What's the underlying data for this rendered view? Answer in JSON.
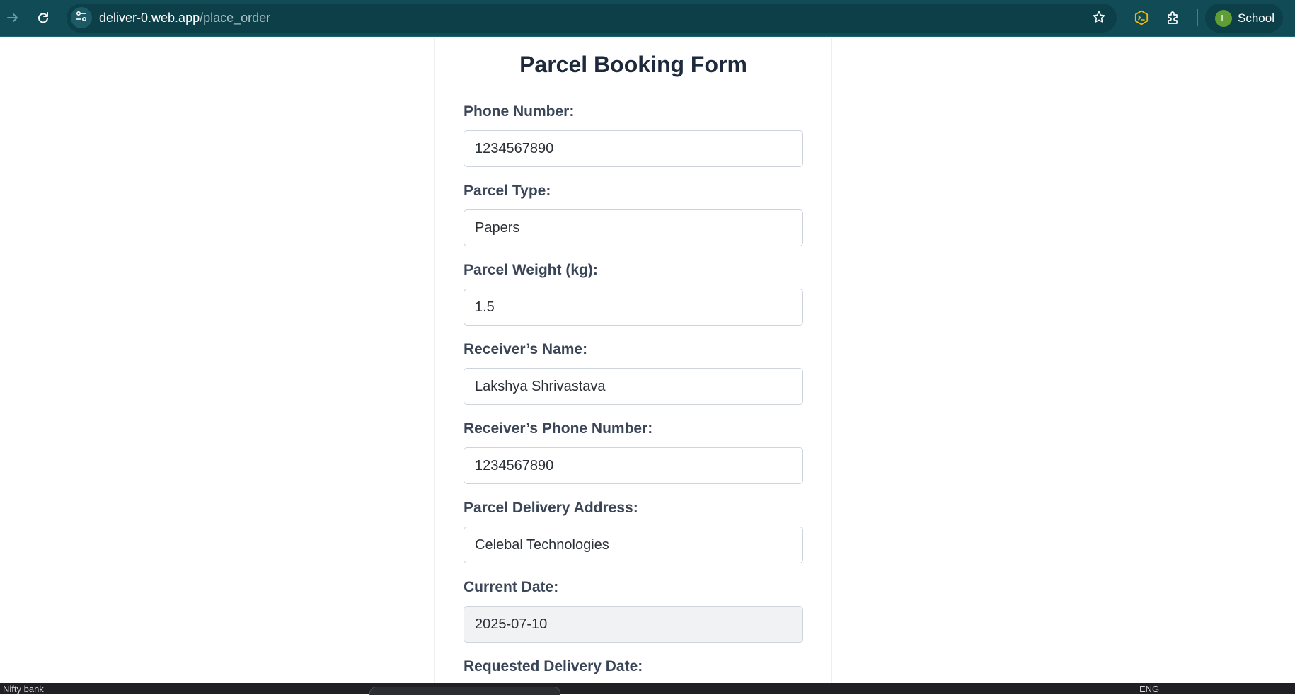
{
  "browser": {
    "url_host": "deliver-0.web.app",
    "url_path": "/place_order",
    "profile_name": "School",
    "profile_initial": "L",
    "icons": {
      "forward": "arrow-right-icon",
      "reload": "reload-icon",
      "site_info": "tune-icon",
      "bookmark": "star-icon",
      "extension_1": "terminal-extension-icon",
      "extensions": "puzzle-icon"
    },
    "colors": {
      "toolbar": "#114b56",
      "omnibox": "#0d3f49",
      "avatar": "#5f9e34",
      "extension_accent": "#f2b900"
    }
  },
  "form": {
    "title": "Parcel Booking Form",
    "fields": [
      {
        "label": "Phone Number:",
        "value": "1234567890"
      },
      {
        "label": "Parcel Type:",
        "value": "Papers"
      },
      {
        "label": "Parcel Weight (kg):",
        "value": "1.5"
      },
      {
        "label": "Receiver’s Name:",
        "value": "Lakshya Shrivastava"
      },
      {
        "label": "Receiver’s Phone Number:",
        "value": "1234567890"
      },
      {
        "label": "Parcel Delivery Address:",
        "value": "Celebal Technologies"
      },
      {
        "label": "Current Date:",
        "value": "2025-07-10",
        "readonly": true
      },
      {
        "label": "Requested Delivery Date:"
      }
    ]
  },
  "taskbar": {
    "left_text": "Nifty bank",
    "lang": "ENG"
  }
}
